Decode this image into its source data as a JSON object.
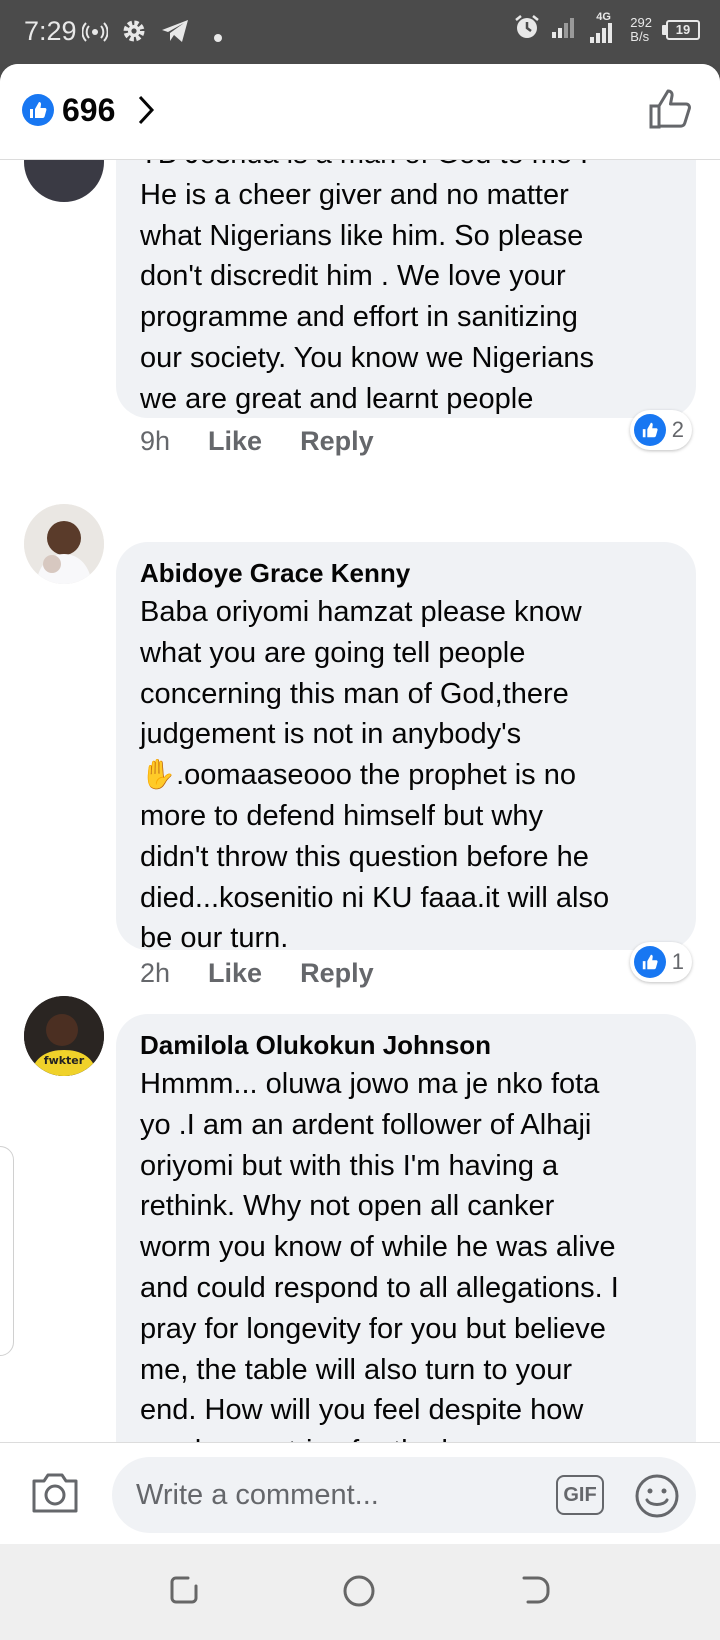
{
  "status_bar": {
    "time": "7:29",
    "network_speed": "292",
    "network_speed_unit": "B/s",
    "network_type": "4G",
    "battery": "19",
    "icons": [
      "hotspot-icon",
      "settings-icon",
      "telegram-icon",
      "dot-icon",
      "alarm-icon",
      "signal-icon",
      "signal-4g-icon",
      "battery-icon"
    ]
  },
  "header": {
    "like_count": "696",
    "icons": [
      "like-badge-icon",
      "chevron-right-icon",
      "thumbs-up-icon"
    ]
  },
  "comments": [
    {
      "author": "",
      "text": "TB Joshua is a man of God to me .\nHe is a cheer giver and no matter\nwhat Nigerians like him. So please\ndon't discredit him . We love your\nprogramme and effort in sanitizing\nour society. You know we Nigerians\nwe are great and learnt people",
      "time": "9h",
      "like_label": "Like",
      "reply_label": "Reply",
      "reactions": "2"
    },
    {
      "author": "Abidoye Grace Kenny",
      "text": "Baba oriyomi hamzat please know\nwhat you are going tell people\nconcerning this man of God,there\njudgement is not in anybody's\n✋.oomaaseooo the prophet is no\nmore to defend himself but why\ndidn't throw this question before he\ndied...kosenitio ni KU faaa.it will also\nbe our turn.",
      "time": "2h",
      "like_label": "Like",
      "reply_label": "Reply",
      "reactions": "1"
    },
    {
      "author": "Damilola Olukokun Johnson",
      "text": "Hmmm... oluwa jowo ma je nko fota\nyo .I am an ardent follower of Alhaji\noriyomi but with this I'm having a\nrethink. Why not open all canker\nworm you know of while he was alive\nand could respond to all allegations. I\npray for longevity for you but believe\nme, the table will also turn to your\nend. How will you feel despite how\nmuch you strive for the human race.",
      "avatar_text": "fwkter"
    }
  ],
  "composer": {
    "placeholder": "Write a comment...",
    "gif_label": "GIF",
    "icons": [
      "camera-icon",
      "emoji-icon"
    ]
  },
  "nav_bar": {
    "icons": [
      "recents-icon",
      "home-icon",
      "back-icon"
    ]
  },
  "colors": {
    "accent": "#1877f2",
    "bubble": "#f0f2f5",
    "secondary_text": "#65676b",
    "status_bar": "#4b4b4b"
  }
}
